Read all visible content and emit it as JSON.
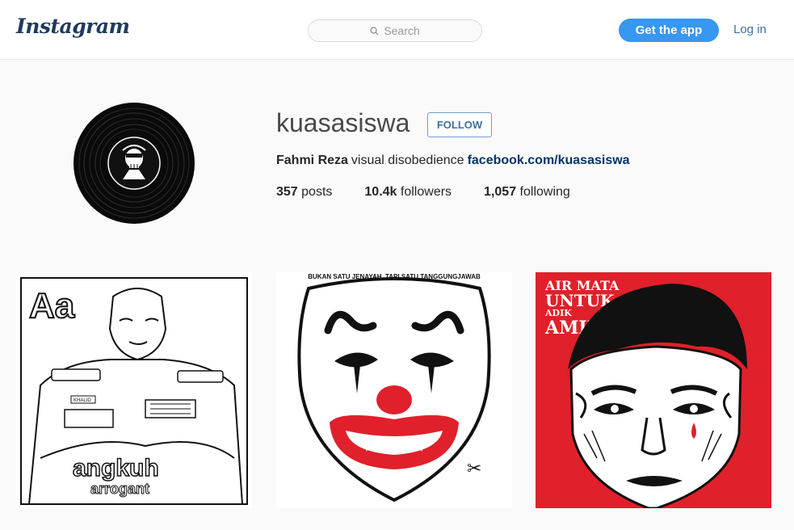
{
  "header": {
    "logo_text": "Instagram",
    "search_placeholder": "Search",
    "get_app_label": "Get the app",
    "login_label": "Log in"
  },
  "profile": {
    "username": "kuasasiswa",
    "follow_label": "FOLLOW",
    "full_name": "Fahmi Reza",
    "bio_text": "visual disobedience",
    "bio_link": "facebook.com/kuasasiswa",
    "stats": {
      "posts_count": "357",
      "posts_label": "posts",
      "followers_count": "10.4k",
      "followers_label": "followers",
      "following_count": "1,057",
      "following_label": "following"
    }
  },
  "posts": [
    {
      "title_letters": "Aa",
      "word": "angkuh",
      "subword": "arrogant",
      "badge": "KHALID"
    },
    {
      "caption": "BUKAN SATU JENAYAH, TAPI SATU TANGGUNGJAWAB"
    },
    {
      "line1": "AIR MATA",
      "line2": "UNTUK",
      "line3": "ADIK",
      "line4": "AMINUL"
    }
  ],
  "colors": {
    "accent": "#3897f0",
    "link": "#003569",
    "poster_red": "#e0202a"
  }
}
